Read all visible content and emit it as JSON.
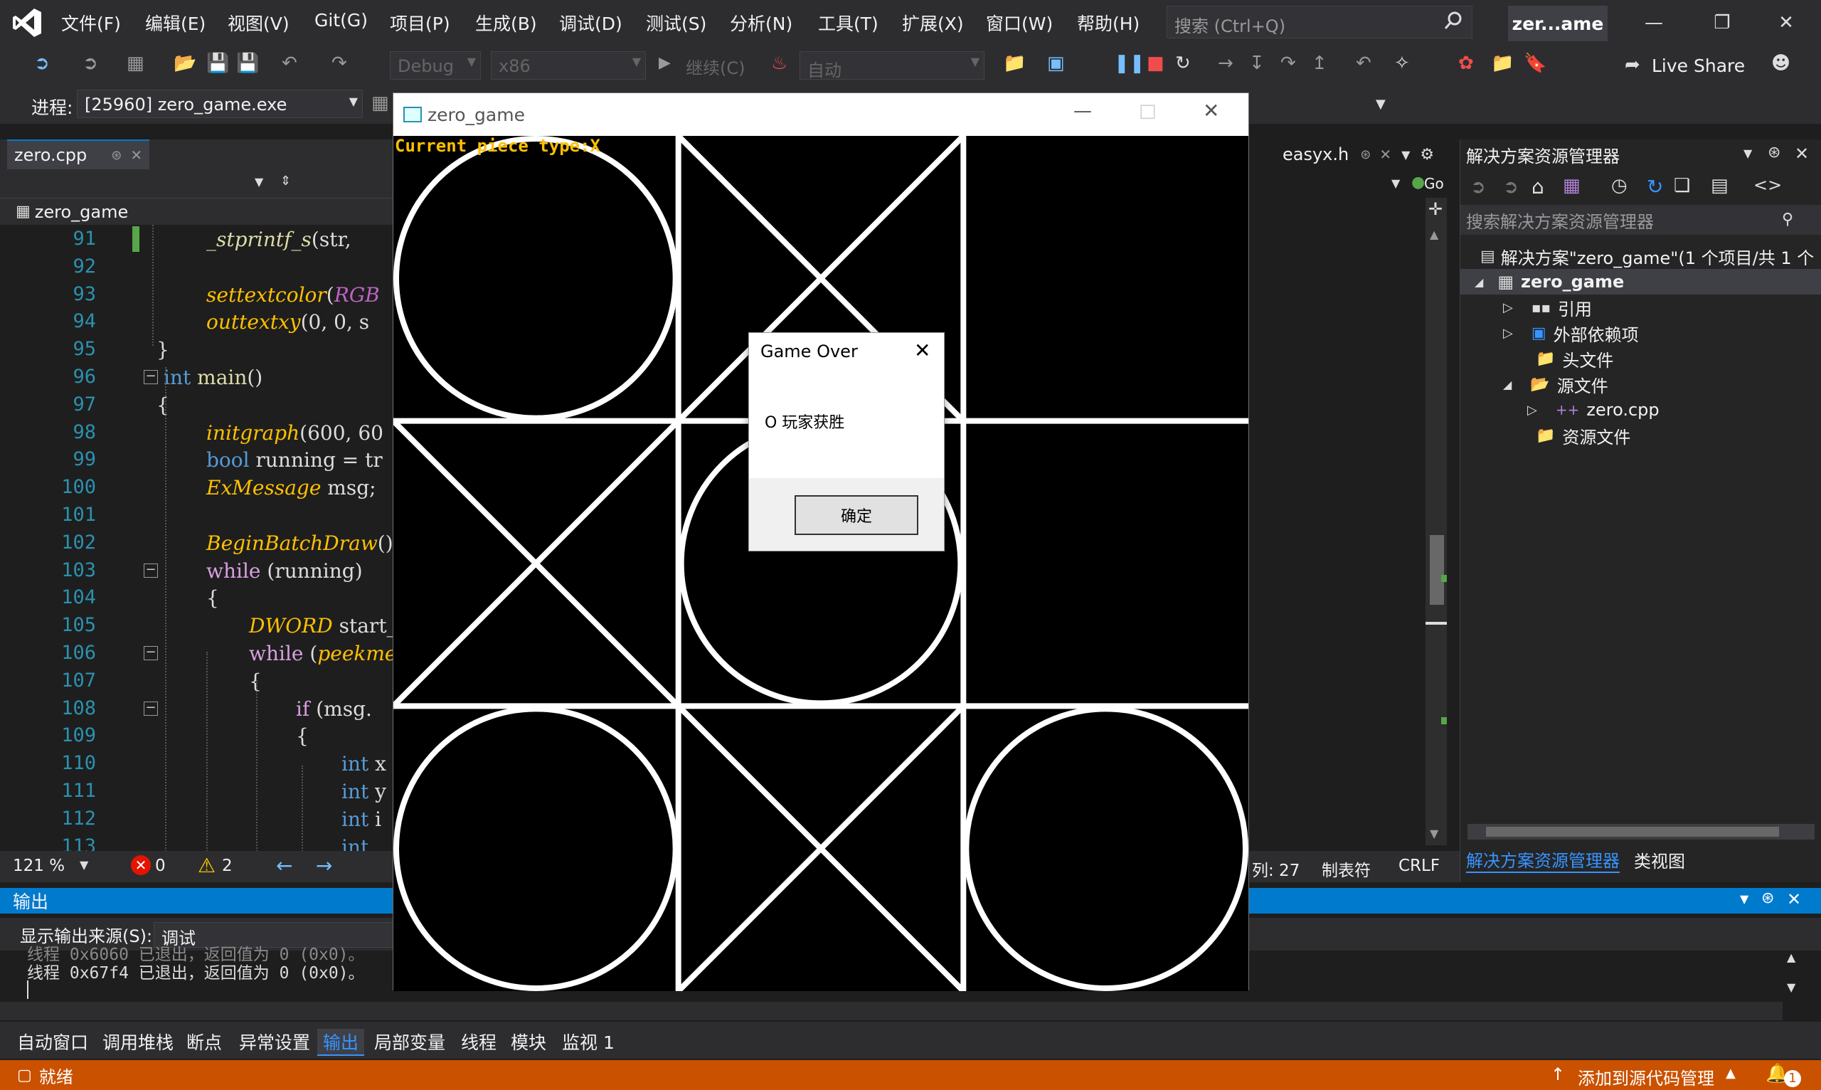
{
  "menu": {
    "items": [
      "文件(F)",
      "编辑(E)",
      "视图(V)",
      "Git(G)",
      "项目(P)",
      "生成(B)",
      "调试(D)",
      "测试(S)",
      "分析(N)",
      "工具(T)",
      "扩展(X)",
      "窗口(W)",
      "帮助(H)"
    ],
    "search_placeholder": "搜索 (Ctrl+Q)",
    "solution_short": "zer...ame"
  },
  "toolbar": {
    "config": "Debug",
    "platform": "x86",
    "continue": "继续(C)",
    "auto": "自动",
    "live_share": "Live Share",
    "process_label": "进程:",
    "process_value": "[25960] zero_game.exe"
  },
  "editor": {
    "tab": "zero.cpp",
    "scope": "zero_game",
    "right_tab": "easyx.h",
    "go_label": "Go",
    "lines": [
      {
        "n": "91",
        "parts": [
          {
            "t": "_stprintf_s",
            "c": "#dcdcaa",
            "i": true
          },
          {
            "t": "(str, ",
            "c": "#dcdcdc"
          }
        ]
      },
      {
        "n": "92",
        "parts": []
      },
      {
        "n": "93",
        "parts": [
          {
            "t": "settextcolor",
            "c": "#ffc000",
            "i": true
          },
          {
            "t": "(",
            "c": "#dcdcdc"
          },
          {
            "t": "RGB",
            "c": "#bd63c5",
            "i": true
          }
        ]
      },
      {
        "n": "94",
        "parts": [
          {
            "t": "outtextxy",
            "c": "#ffc000",
            "i": true
          },
          {
            "t": "(0, 0, s",
            "c": "#dcdcdc"
          }
        ]
      },
      {
        "n": "95",
        "parts": [
          {
            "t": "}",
            "c": "#dcdcdc"
          }
        ]
      },
      {
        "n": "96",
        "parts": [
          {
            "t": "int ",
            "c": "#569cd6"
          },
          {
            "t": "main",
            "c": "#dcdcaa"
          },
          {
            "t": "()",
            "c": "#dcdcdc"
          }
        ]
      },
      {
        "n": "97",
        "parts": [
          {
            "t": "{",
            "c": "#dcdcdc"
          }
        ]
      },
      {
        "n": "98",
        "parts": [
          {
            "t": "initgraph",
            "c": "#ffc000",
            "i": true
          },
          {
            "t": "(600, 60",
            "c": "#dcdcdc"
          }
        ]
      },
      {
        "n": "99",
        "parts": [
          {
            "t": "bool ",
            "c": "#569cd6"
          },
          {
            "t": "running = tr",
            "c": "#dcdcdc"
          }
        ]
      },
      {
        "n": "100",
        "parts": [
          {
            "t": "ExMessage",
            "c": "#ffc000",
            "i": true
          },
          {
            "t": " msg;",
            "c": "#dcdcdc"
          }
        ]
      },
      {
        "n": "101",
        "parts": []
      },
      {
        "n": "102",
        "parts": [
          {
            "t": "BeginBatchDraw",
            "c": "#ffc000",
            "i": true
          },
          {
            "t": "();",
            "c": "#dcdcdc"
          }
        ]
      },
      {
        "n": "103",
        "parts": [
          {
            "t": "while ",
            "c": "#d8a0df"
          },
          {
            "t": "(running)",
            "c": "#dcdcdc"
          }
        ]
      },
      {
        "n": "104",
        "parts": [
          {
            "t": "{",
            "c": "#dcdcdc"
          }
        ]
      },
      {
        "n": "105",
        "parts": [
          {
            "t": "DWORD",
            "c": "#ffc000",
            "i": true
          },
          {
            "t": " start_t",
            "c": "#dcdcdc"
          }
        ]
      },
      {
        "n": "106",
        "parts": [
          {
            "t": "while ",
            "c": "#d8a0df"
          },
          {
            "t": "(",
            "c": "#dcdcdc"
          },
          {
            "t": "peekme",
            "c": "#ffc000",
            "i": true
          }
        ]
      },
      {
        "n": "107",
        "parts": [
          {
            "t": "{",
            "c": "#dcdcdc"
          }
        ]
      },
      {
        "n": "108",
        "parts": [
          {
            "t": "if ",
            "c": "#d8a0df"
          },
          {
            "t": "(msg.",
            "c": "#dcdcdc"
          }
        ]
      },
      {
        "n": "109",
        "parts": [
          {
            "t": "{",
            "c": "#dcdcdc"
          }
        ]
      },
      {
        "n": "110",
        "parts": [
          {
            "t": "int ",
            "c": "#569cd6"
          },
          {
            "t": "x",
            "c": "#dcdcdc"
          }
        ]
      },
      {
        "n": "111",
        "parts": [
          {
            "t": "int ",
            "c": "#569cd6"
          },
          {
            "t": "y",
            "c": "#dcdcdc"
          }
        ]
      },
      {
        "n": "112",
        "parts": [
          {
            "t": "int ",
            "c": "#569cd6"
          },
          {
            "t": "i",
            "c": "#dcdcdc"
          }
        ]
      },
      {
        "n": "113",
        "parts": [
          {
            "t": "int ",
            "c": "#569cd6"
          }
        ]
      }
    ],
    "zoom": "121 %",
    "errors": "0",
    "warnings": "2",
    "col": "列: 27",
    "tabs_mode": "制表符",
    "eol": "CRLF"
  },
  "solution_explorer": {
    "title": "解决方案资源管理器",
    "search_placeholder": "搜索解决方案资源管理器",
    "solution": "解决方案\"zero_game\"(1 个项目/共 1 个",
    "project": "zero_game",
    "nodes": [
      "引用",
      "外部依赖项",
      "头文件",
      "源文件",
      "zero.cpp",
      "资源文件"
    ],
    "tab_active": "解决方案资源管理器",
    "tab_other": "类视图"
  },
  "output": {
    "title": "输出",
    "source_label": "显示输出来源(S):",
    "source_value": "调试",
    "line_partial": "线程 0x6060 已退出，返回值为 0 (0x0)。",
    "line": "线程 0x67f4 已退出，返回值为 0 (0x0)。"
  },
  "bottom_tabs": [
    "自动窗口",
    "调用堆栈",
    "断点",
    "异常设置",
    "输出",
    "局部变量",
    "线程",
    "模块",
    "监视 1"
  ],
  "status": {
    "ready": "就绪",
    "source_control": "添加到源代码管理",
    "notifications": "1"
  },
  "game": {
    "title": "zero_game",
    "status_text": "Current piece type:X",
    "board": [
      "O",
      "X",
      "",
      "X",
      "O",
      "",
      "O",
      "X",
      "O"
    ]
  },
  "dialog": {
    "title": "Game Over",
    "message": "O 玩家获胜",
    "ok": "确定"
  },
  "colors": {
    "accent": "#007acc",
    "statusbar": "#ca5100",
    "game_text": "#ffc000"
  }
}
